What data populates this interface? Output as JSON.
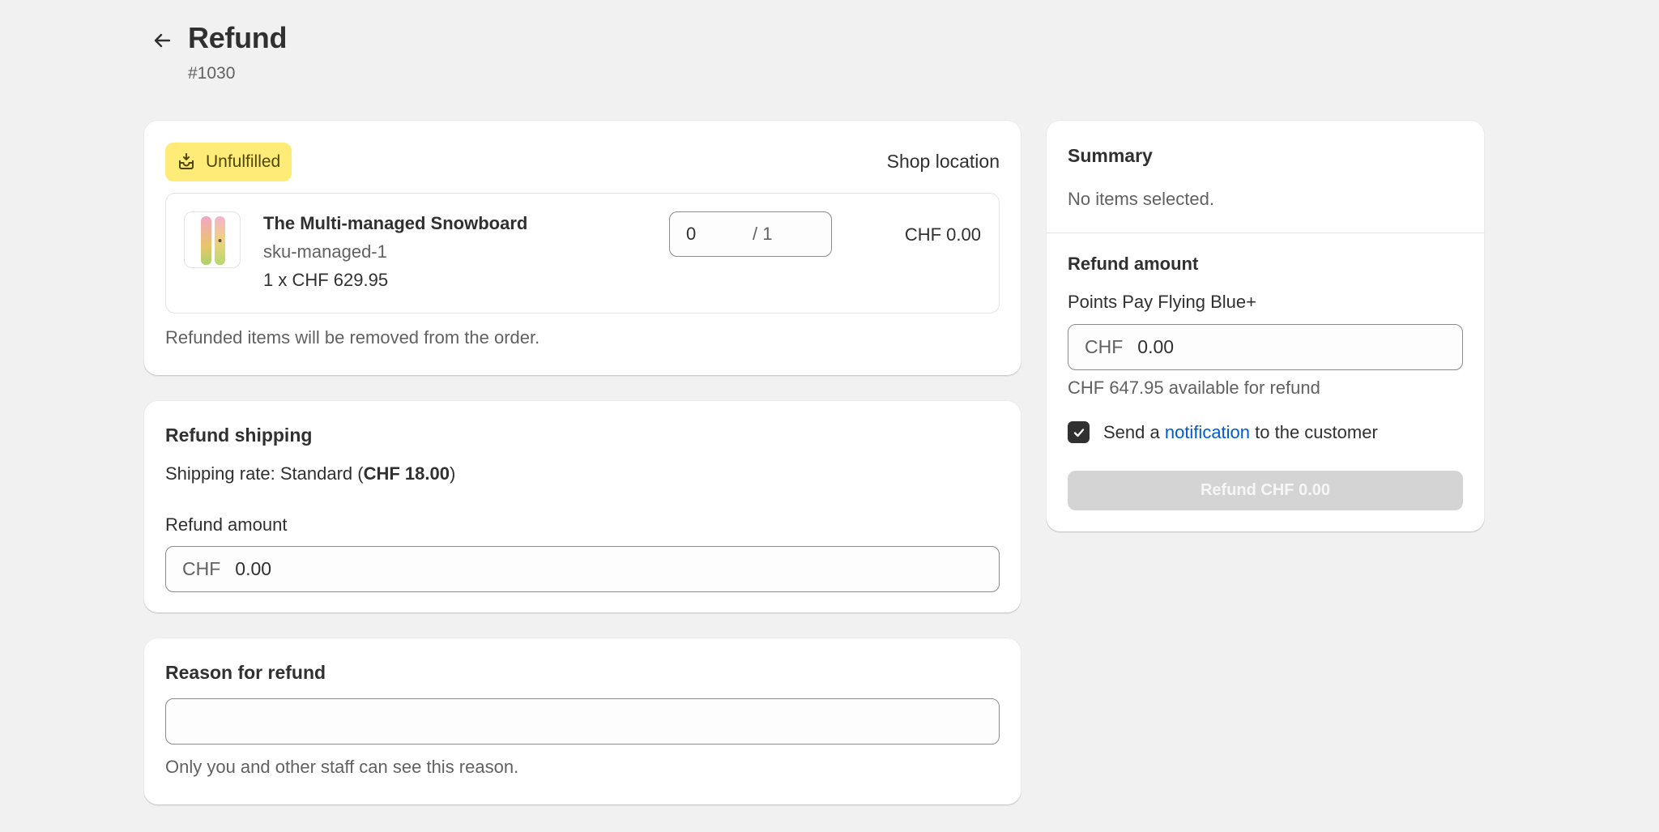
{
  "header": {
    "title": "Refund",
    "order_number": "#1030"
  },
  "items_card": {
    "status_badge": "Unfulfilled",
    "location": "Shop location",
    "line_item": {
      "title": "The Multi-managed Snowboard",
      "sku": "sku-managed-1",
      "price_line": "1 x CHF 629.95",
      "quantity_value": "0",
      "quantity_total": "/ 1",
      "line_total": "CHF 0.00"
    },
    "help_text": "Refunded items will be removed from the order."
  },
  "shipping_card": {
    "heading": "Refund shipping",
    "rate_prefix": "Shipping rate: Standard (",
    "rate_amount": "CHF 18.00",
    "rate_suffix": ")",
    "amount_label": "Refund amount",
    "currency_prefix": "CHF",
    "amount_value": "0.00"
  },
  "reason_card": {
    "heading": "Reason for refund",
    "value": "",
    "help_text": "Only you and other staff can see this reason."
  },
  "summary_card": {
    "heading": "Summary",
    "empty_text": "No items selected.",
    "refund_heading": "Refund amount",
    "payment_method": "Points Pay Flying Blue+",
    "currency_prefix": "CHF",
    "amount_value": "0.00",
    "available_text": "CHF 647.95 available for refund",
    "notify_prefix": "Send a ",
    "notify_link": "notification",
    "notify_suffix": " to the customer",
    "notify_checked": true,
    "refund_button": "Refund CHF 0.00"
  },
  "colors": {
    "background": "#f1f1f1",
    "badge_bg": "#ffeb78",
    "link": "#005bd3",
    "disabled_button": "#d4d4d4"
  },
  "icons": {
    "back": "arrow-left-icon",
    "badge": "inbox-icon",
    "checkbox": "checkmark-icon",
    "product": "snowboard-thumbnail"
  }
}
